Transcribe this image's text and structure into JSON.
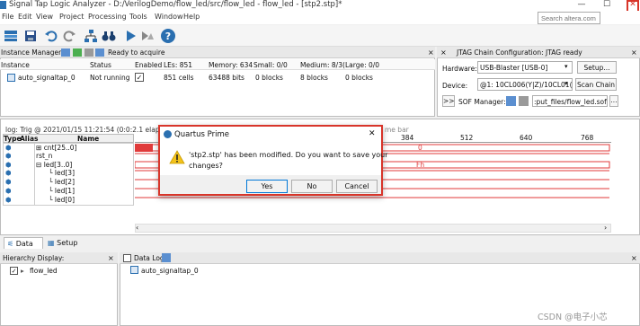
{
  "window": {
    "title": "Signal Tap Logic Analyzer - D:/VerilogDemo/flow_led/src/flow_led - flow_led - [stp2.stp]*",
    "minimize": "—",
    "maximize": "☐",
    "close": "✕"
  },
  "menu": [
    "File",
    "Edit",
    "View",
    "Project",
    "Processing",
    "Tools",
    "Window",
    "Help"
  ],
  "search": {
    "placeholder": "Search altera.com"
  },
  "instance_manager": {
    "label": "Instance Manager:",
    "status": "Ready to acquire",
    "columns": [
      "Instance",
      "Status",
      "Enabled",
      "LEs: 851",
      "Memory: 634",
      "Small: 0/0",
      "Medium: 8/3(",
      "Large: 0/0"
    ],
    "row": {
      "instance": "auto_signaltap_0",
      "status": "Not running",
      "enabled": "✓",
      "les": "851 cells",
      "memory": "63488 bits",
      "small": "0 blocks",
      "medium": "8 blocks",
      "large": "0 blocks"
    }
  },
  "jtag": {
    "header": "JTAG Chain Configuration: JTAG ready",
    "hardware_label": "Hardware:",
    "hardware_value": "USB-Blaster [USB-0]",
    "setup_button": "Setup...",
    "device_label": "Device:",
    "device_value": "@1: 10CL006(Y|Z)/10CL01(",
    "scan_button": "Scan Chain",
    "more_button": ">>",
    "sof_label": "SOF Manager:",
    "sof_file": ":put_files/flow_led.sof",
    "sof_browse": "..."
  },
  "waveform": {
    "log_text": "log: Trig @ 2021/01/15 11:21:54 (0:0:2.1 elaps",
    "time_bar": "me bar",
    "headers": [
      "Type",
      "Alias",
      "Name"
    ],
    "ticks": [
      "384",
      "512",
      "640",
      "768"
    ],
    "signals": [
      {
        "name": "cnt[25..0]",
        "prefix": "⊞"
      },
      {
        "name": "rst_n",
        "prefix": ""
      },
      {
        "name": "led[3..0]",
        "prefix": "⊟"
      },
      {
        "name": "led[3]",
        "prefix": ""
      },
      {
        "name": "led[2]",
        "prefix": ""
      },
      {
        "name": "led[1]",
        "prefix": ""
      },
      {
        "name": "led[0]",
        "prefix": ""
      }
    ],
    "values": {
      "cnt": "0",
      "led": "Fh"
    }
  },
  "tabs": {
    "data": "Data",
    "setup": "Setup"
  },
  "hierarchy": {
    "title": "Hierarchy Display:",
    "item": "flow_led",
    "close": "×"
  },
  "datalog": {
    "title": "Data Log:",
    "item": "auto_signaltap_0",
    "close": "×"
  },
  "dialog": {
    "title": "Quartus Prime",
    "message_line1": "'stp2.stp' has been modified. Do you want to save your",
    "message_line2": "changes?",
    "yes": "Yes",
    "no": "No",
    "cancel": "Cancel",
    "close": "✕"
  },
  "watermark": "CSDN @电子小芯",
  "colors": {
    "accent_red": "#d8352a",
    "wave_red": "#e03a3a",
    "brand_blue": "#2a6fb0"
  }
}
